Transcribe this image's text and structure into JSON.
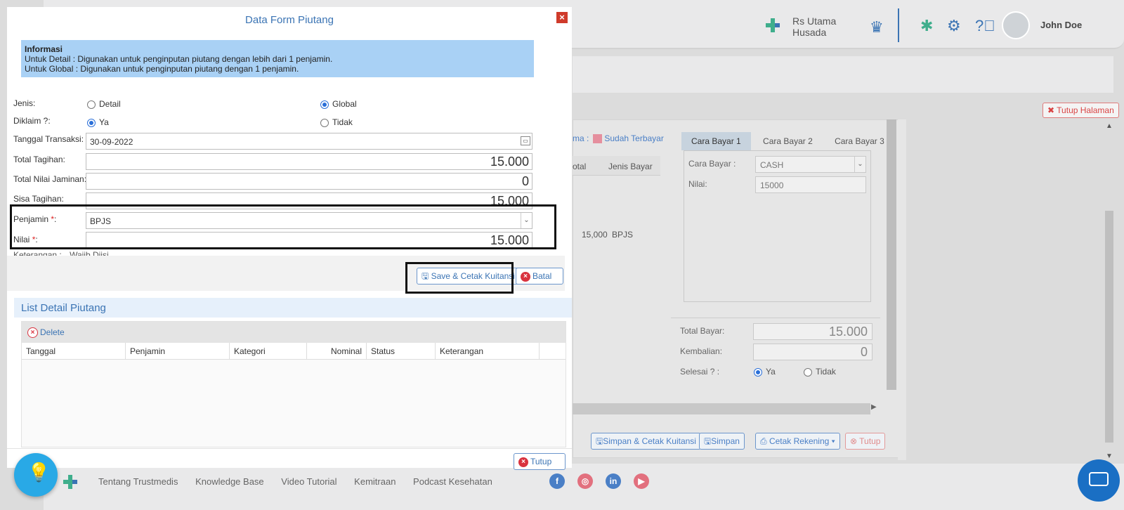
{
  "app": {
    "hospital": [
      "Rs Utama",
      "Husada"
    ],
    "user": "John Doe",
    "close_page": "Tutup Halaman"
  },
  "background": {
    "legend_prefix": "ma :",
    "legend_paid": "Sudah Terbayar",
    "table_headers": [
      "otal",
      "Jenis Bayar"
    ],
    "row": {
      "total": "15,000",
      "jenis": "BPJS"
    },
    "pay_tabs": [
      "Cara Bayar 1",
      "Cara Bayar 2",
      "Cara Bayar 3"
    ],
    "cara_bayar_label": "Cara Bayar :",
    "cara_bayar_value": "CASH",
    "nilai_label": "Nilai:",
    "nilai_value": "15000",
    "total_bayar_label": "Total Bayar:",
    "total_bayar_value": "15.000",
    "kembalian_label": "Kembalian:",
    "kembalian_value": "0",
    "selesai_label": "Selesai ? :",
    "selesai_ya": "Ya",
    "selesai_tidak": "Tidak",
    "buttons": [
      "Simpan & Cetak Kuitansi",
      "Simpan",
      "Cetak Rekening",
      "Tutup"
    ]
  },
  "footer": {
    "links": [
      "Tentang Trustmedis",
      "Knowledge Base",
      "Video Tutorial",
      "Kemitraan",
      "Podcast Kesehatan"
    ]
  },
  "modal": {
    "title": "Data Form Piutang",
    "info_title": "Informasi",
    "info_line1": "Untuk Detail : Digunakan untuk penginputan piutang dengan lebih dari 1 penjamin.",
    "info_line2": "Untuk Global : Digunakan untuk penginputan piutang dengan 1 penjamin.",
    "jenis_label": "Jenis:",
    "jenis_detail": "Detail",
    "jenis_global": "Global",
    "diklaim_label": "Diklaim ?:",
    "diklaim_ya": "Ya",
    "diklaim_tidak": "Tidak",
    "tanggal_label": "Tanggal Transaksi:",
    "tanggal_value": "30-09-2022",
    "total_tagihan_label": "Total Tagihan:",
    "total_tagihan_value": "15.000",
    "total_jaminan_label": "Total Nilai Jaminan:",
    "total_jaminan_value": "0",
    "sisa_label": "Sisa Tagihan:",
    "sisa_value": "15.000",
    "penjamin_label": "Penjamin",
    "penjamin_value": "BPJS",
    "nilai_label": "Nilai",
    "nilai_value": "15.000",
    "keterangan_label": "Keterangan :",
    "keterangan_value": "Wajib Diisi",
    "save_button": "Save & Cetak Kuitansi",
    "batal_button": "Batal",
    "section_title": "List Detail Piutang",
    "delete_button": "Delete",
    "grid_headers": [
      "Tanggal",
      "Penjamin",
      "Kategori",
      "Nominal",
      "Status",
      "Keterangan"
    ],
    "tutup_button": "Tutup"
  },
  "colors": {
    "accent": "#3b74b4",
    "info_bg": "#a9d1f5",
    "danger": "#d9333f"
  }
}
